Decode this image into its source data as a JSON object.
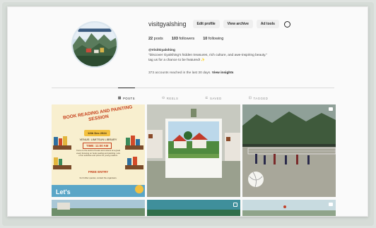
{
  "profile": {
    "username": "visitgyalshing",
    "edit_label": "Edit profile",
    "archive_label": "View archive",
    "adtools_label": "Ad tools",
    "posts_count": "22",
    "posts_label": "posts",
    "followers_count": "103",
    "followers_label": "followers",
    "following_count": "10",
    "following_label": "following",
    "display_name": "@VisitGyalshing",
    "bio_line1": "\"Discover Gyalshing's hidden treasures, rich culture, and awe-inspiring beauty.\"",
    "bio_line2": "tag us for a chance to be featured!",
    "bio_emoji": "✨",
    "insights_text": "373 accounts reached in the last 30 days.",
    "insights_link": "View insights"
  },
  "tabs": [
    {
      "label": "POSTS",
      "icon": "grid-icon"
    },
    {
      "label": "REELS",
      "icon": "reels-icon"
    },
    {
      "label": "SAVED",
      "icon": "bookmark-icon"
    },
    {
      "label": "TAGGED",
      "icon": "tag-icon"
    }
  ],
  "poster": {
    "title": "BOOK READING AND PAINTING SESSION",
    "date": "12th Dec 2024",
    "venue": "VENUE: LIMITSUN LIBRARY",
    "time": "TIME: 11:00 AM",
    "body": "Come to the world of books and colours at a great event focusing on book reading and painting. Lots of fun activities and prizes for young readers.",
    "entry": "FREE ENTRY",
    "foot": "For further queries, contact the organisers.",
    "lets": "Let's"
  },
  "colors": {
    "accent": "#0095f6",
    "text": "#262626",
    "muted": "#8e8e8e"
  }
}
